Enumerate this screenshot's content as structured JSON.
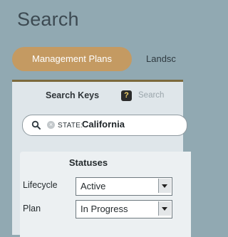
{
  "page": {
    "title": "Search"
  },
  "tabs": [
    {
      "label": "Management Plans",
      "active": true
    },
    {
      "label": "Landsc",
      "active": false
    }
  ],
  "search": {
    "heading": "Search Keys",
    "help_glyph": "?",
    "hint": "Search",
    "chip_key": "STATE:",
    "chip_value": "California"
  },
  "statuses": {
    "heading": "Statuses",
    "lifecycle_label": "Lifecycle",
    "lifecycle_value": "Active",
    "plan_label": "Plan",
    "plan_value": "In Progress"
  },
  "colors": {
    "background": "#91a9b2",
    "active_tab": "#c49a62",
    "panel": "#dfe6ea",
    "panel_border": "#7c6a3c"
  }
}
